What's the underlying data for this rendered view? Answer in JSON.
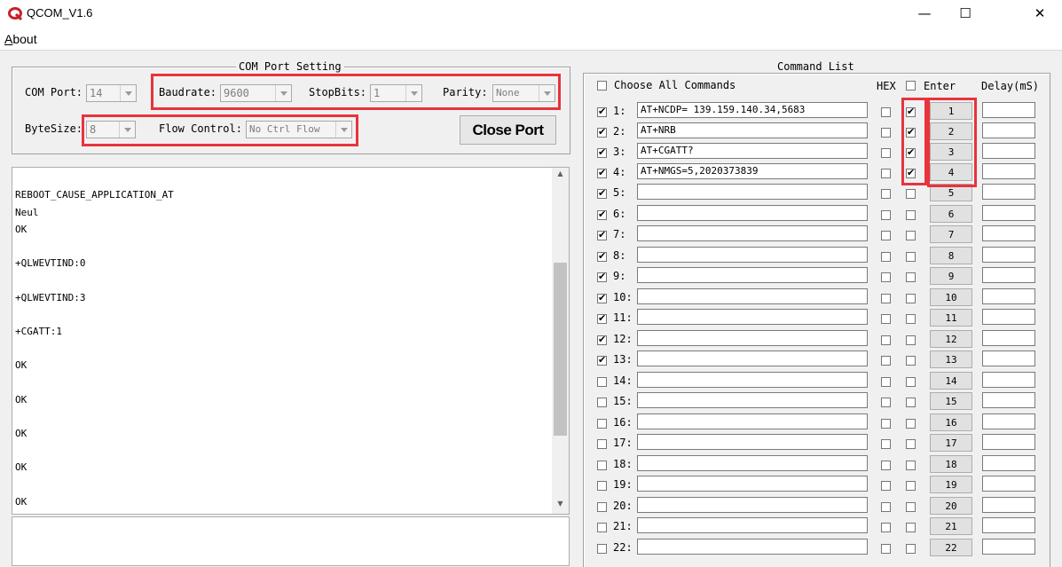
{
  "window": {
    "title": "QCOM_V1.6",
    "min": "—",
    "max": "☐",
    "close": "✕"
  },
  "menu": {
    "about": "About"
  },
  "port": {
    "group_title": "COM Port Setting",
    "com_label": "COM Port:",
    "com_value": "14",
    "baud_label": "Baudrate:",
    "baud_value": "9600",
    "stop_label": "StopBits:",
    "stop_value": "1",
    "parity_label": "Parity:",
    "parity_value": "None",
    "bytesize_label": "ByteSize:",
    "bytesize_value": "8",
    "flow_label": "Flow Control:",
    "flow_value": "No Ctrl Flow",
    "close_button": "Close Port"
  },
  "log": {
    "lines": [
      "REBOOT_CAUSE_APPLICATION_AT",
      "Neul",
      "OK",
      "+QLWEVTIND:0",
      "+QLWEVTIND:3",
      "+CGATT:1",
      "OK",
      "OK",
      "OK",
      "OK",
      "OK"
    ],
    "scroll_up": "▲",
    "scroll_down": "▼"
  },
  "commands": {
    "group_title": "Command List",
    "choose_all": "Choose All Commands",
    "hex_header": "HEX",
    "enter_header": "Enter",
    "delay_header": "Delay(mS)",
    "rows": [
      {
        "num": "1:",
        "checked": true,
        "text": "AT+NCDP= 139.159.140.34,5683",
        "enter": true,
        "button": "1"
      },
      {
        "num": "2:",
        "checked": true,
        "text": "AT+NRB",
        "enter": true,
        "button": "2"
      },
      {
        "num": "3:",
        "checked": true,
        "text": "AT+CGATT?",
        "enter": true,
        "button": "3"
      },
      {
        "num": "4:",
        "checked": true,
        "text": "AT+NMGS=5,2020373839",
        "enter": true,
        "button": "4"
      },
      {
        "num": "5:",
        "checked": true,
        "text": "",
        "enter": false,
        "button": "5"
      },
      {
        "num": "6:",
        "checked": true,
        "text": "",
        "enter": false,
        "button": "6"
      },
      {
        "num": "7:",
        "checked": true,
        "text": "",
        "enter": false,
        "button": "7"
      },
      {
        "num": "8:",
        "checked": true,
        "text": "",
        "enter": false,
        "button": "8"
      },
      {
        "num": "9:",
        "checked": true,
        "text": "",
        "enter": false,
        "button": "9"
      },
      {
        "num": "10:",
        "checked": true,
        "text": "",
        "enter": false,
        "button": "10"
      },
      {
        "num": "11:",
        "checked": true,
        "text": "",
        "enter": false,
        "button": "11"
      },
      {
        "num": "12:",
        "checked": true,
        "text": "",
        "enter": false,
        "button": "12"
      },
      {
        "num": "13:",
        "checked": true,
        "text": "",
        "enter": false,
        "button": "13"
      },
      {
        "num": "14:",
        "checked": false,
        "text": "",
        "enter": false,
        "button": "14"
      },
      {
        "num": "15:",
        "checked": false,
        "text": "",
        "enter": false,
        "button": "15"
      },
      {
        "num": "16:",
        "checked": false,
        "text": "",
        "enter": false,
        "button": "16"
      },
      {
        "num": "17:",
        "checked": false,
        "text": "",
        "enter": false,
        "button": "17"
      },
      {
        "num": "18:",
        "checked": false,
        "text": "",
        "enter": false,
        "button": "18"
      },
      {
        "num": "19:",
        "checked": false,
        "text": "",
        "enter": false,
        "button": "19"
      },
      {
        "num": "20:",
        "checked": false,
        "text": "",
        "enter": false,
        "button": "20"
      },
      {
        "num": "21:",
        "checked": false,
        "text": "",
        "enter": false,
        "button": "21"
      },
      {
        "num": "22:",
        "checked": false,
        "text": "",
        "enter": false,
        "button": "22"
      }
    ]
  },
  "colors": {
    "highlight": "#e8333d",
    "window_bg": "#f0f0f0",
    "thumb": "#c2c2c2"
  }
}
